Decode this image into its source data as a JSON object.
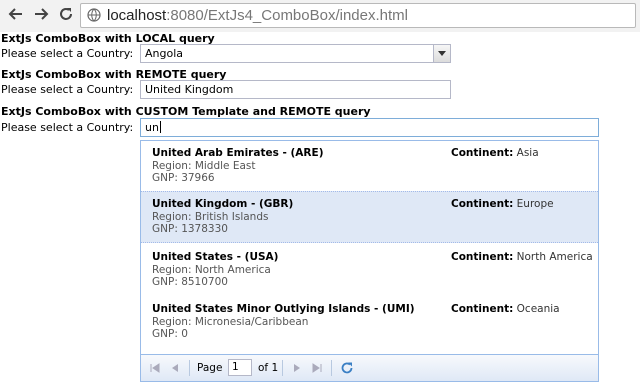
{
  "browser": {
    "url_host": "localhost",
    "url_path": ":8080/ExtJs4_ComboBox/index.html"
  },
  "sections": [
    {
      "title": "ExtJs ComboBox with LOCAL query",
      "label": "Please select a Country:",
      "value": "Angola"
    },
    {
      "title": "ExtJs ComboBox with REMOTE query",
      "label": "Please select a Country:",
      "value": "United Kingdom"
    },
    {
      "title": "ExtJs ComboBox with CUSTOM Template and REMOTE query",
      "label": "Please select a Country:",
      "value": "un"
    }
  ],
  "results": [
    {
      "name": "United Arab Emirates - (ARE)",
      "region": "Region: Middle East",
      "gnp": "GNP: 37966",
      "continent_label": "Continent:",
      "continent": " Asia"
    },
    {
      "name": "United Kingdom - (GBR)",
      "region": "Region: British Islands",
      "gnp": "GNP: 1378330",
      "continent_label": "Continent:",
      "continent": " Europe"
    },
    {
      "name": "United States - (USA)",
      "region": "Region: North America",
      "gnp": "GNP: 8510700",
      "continent_label": "Continent:",
      "continent": " North America"
    },
    {
      "name": "United States Minor Outlying Islands - (UMI)",
      "region": "Region: Micronesia/Caribbean",
      "gnp": "GNP: 0",
      "continent_label": "Continent:",
      "continent": " Oceania"
    }
  ],
  "pager": {
    "page_label": "Page",
    "page_value": "1",
    "of_label": "of 1"
  },
  "colors": {
    "selected_row": "#dfe8f6",
    "picker_border": "#99bbe8"
  }
}
